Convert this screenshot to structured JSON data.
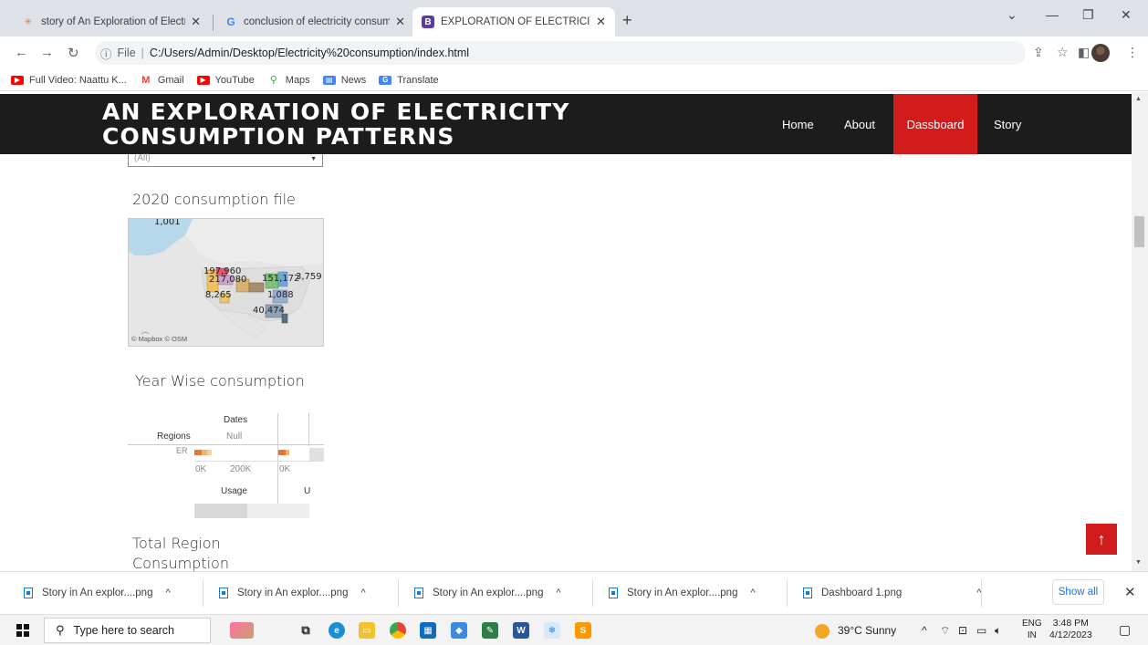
{
  "browser": {
    "tabs": [
      {
        "title": "story of An Exploration of Electric",
        "favicon": "tableau-icon",
        "active": false
      },
      {
        "title": "conclusion of electricity consump",
        "favicon": "google-icon",
        "active": false
      },
      {
        "title": "EXPLORATION OF ELECTRICITY C",
        "favicon": "bootstrap-icon",
        "active": true
      }
    ],
    "new_tab_label": "+",
    "address": {
      "scheme_label": "File",
      "url": "C:/Users/Admin/Desktop/Electricity%20consumption/index.html"
    },
    "bookmarks": [
      {
        "label": "Full Video: Naattu K...",
        "icon": "youtube-icon",
        "color": "#ff0000"
      },
      {
        "label": "Gmail",
        "icon": "gmail-icon",
        "color": "#ea4335"
      },
      {
        "label": "YouTube",
        "icon": "youtube-icon",
        "color": "#ff0000"
      },
      {
        "label": "Maps",
        "icon": "maps-icon",
        "color": "#34a853"
      },
      {
        "label": "News",
        "icon": "news-icon",
        "color": "#4285f4"
      },
      {
        "label": "Translate",
        "icon": "translate-icon",
        "color": "#4285f4"
      }
    ]
  },
  "site": {
    "title_line1": "AN EXPLORATION OF ELECTRICITY",
    "title_line2": "CONSUMPTION PATTERNS",
    "nav": [
      {
        "label": "Home",
        "active": false
      },
      {
        "label": "About",
        "active": false
      },
      {
        "label": "Dassboard",
        "active": true
      },
      {
        "label": "Story",
        "active": false
      }
    ],
    "accent_color": "#d21b1b",
    "filter_value": "(All)",
    "sections": {
      "map_title": "2020 consumption file",
      "yearwise_title": "Year Wise consumption",
      "total_title_line1": "Total Region",
      "total_title_line2": "Consumption"
    },
    "map": {
      "labels": [
        "1,001",
        "197,960",
        "217,080",
        "151,172",
        "3,759",
        "8,265",
        "1,088",
        "40,474"
      ],
      "attribution": "© Mapbox © OSM"
    },
    "yearwise": {
      "column_header": "Dates",
      "row_header": "Regions",
      "null_label": "Null",
      "row_label": "ER",
      "axis_ticks": [
        "0K",
        "200K",
        "0K"
      ],
      "axis_title": "Usage",
      "axis_title_partial": "U"
    },
    "scroll_top_icon": "arrow-up-icon"
  },
  "downloads": {
    "items": [
      "Story in An explor....png",
      "Story in An explor....png",
      "Story in An explor....png",
      "Story in An explor....png",
      "Dashboard 1.png"
    ],
    "show_all_label": "Show all"
  },
  "taskbar": {
    "search_placeholder": "Type here to search",
    "weather": "39°C  Sunny",
    "lang_top": "ENG",
    "lang_bottom": "IN",
    "time": "3:48 PM",
    "date": "4/12/2023"
  }
}
